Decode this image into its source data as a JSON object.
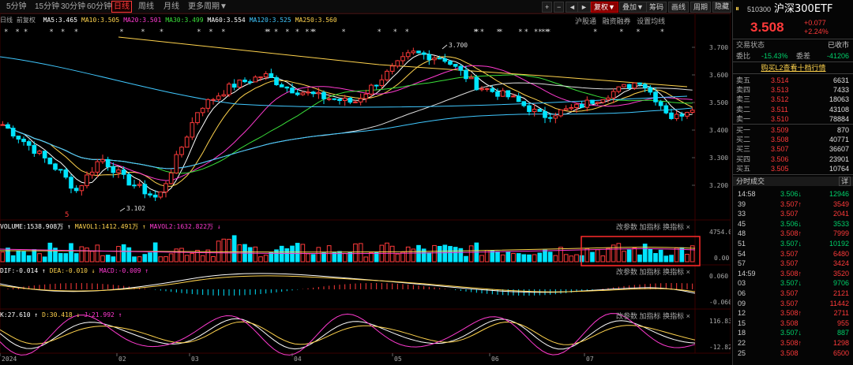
{
  "toolbar": {
    "tabs": [
      "5分钟",
      "15分钟",
      "30分钟",
      "60分钟",
      "日线",
      "周线",
      "月线",
      "更多周期"
    ],
    "active_tab": "日线",
    "more_arrow": "▼",
    "nav": [
      "+",
      "−",
      "◄",
      "►"
    ],
    "fq_label": "复权",
    "buttons": [
      "叠加",
      "筹码",
      "画线",
      "周期",
      "隐藏"
    ],
    "gear": "⚙"
  },
  "chart_header": {
    "stars_left": "* * *** *     *  *    *  *      *  *  *       ***  ** *    *",
    "legend_prefix": "日线 前复权",
    "ma": [
      {
        "label": "MA5:3.465",
        "color": "#ffffff"
      },
      {
        "label": "MA10:3.505",
        "color": "#ffd34d"
      },
      {
        "label": "MA20:3.501",
        "color": "#ff3ad0"
      },
      {
        "label": "MA30:3.499",
        "color": "#3adf3a"
      },
      {
        "label": "MA60:3.554",
        "color": "#ffffff"
      },
      {
        "label": "MA120:3.525",
        "color": "#40c8ff"
      },
      {
        "label": "MA250:3.560",
        "color": "#ffd34d"
      }
    ],
    "right_labels": [
      "沪股通",
      "融资融券",
      "设置均线"
    ],
    "high_label": "3.700",
    "low_label": "3.102",
    "low_marker": "5"
  },
  "price_axis": [
    "3.700",
    "3.600",
    "3.500",
    "3.400",
    "3.300",
    "3.200"
  ],
  "volume_pane": {
    "legend": [
      {
        "label": "VOLUME:1538.908万 ↑",
        "color": "#ffffff"
      },
      {
        "label": "MAVOL1:1412.491万 ↑",
        "color": "#ffd34d"
      },
      {
        "label": "MAVOL2:1632.822万 ↓",
        "color": "#ff3ad0"
      }
    ],
    "buttons": [
      "改参数",
      "加指标",
      "换指标",
      "×"
    ],
    "axis": [
      "4754.00",
      "0.00"
    ]
  },
  "macd_pane": {
    "legend": [
      {
        "label": "DIF:-0.014 ↑",
        "color": "#ffffff"
      },
      {
        "label": "DEA:-0.010 ↓",
        "color": "#ffd34d"
      },
      {
        "label": "MACD:-0.009 ↑",
        "color": "#ff3ad0"
      }
    ],
    "buttons": [
      "改参数",
      "加指标",
      "换指标",
      "×"
    ],
    "axis": [
      "0.060",
      "-0.060"
    ]
  },
  "kdj_pane": {
    "legend": [
      {
        "label": "K:27.610 ↑",
        "color": "#ffffff"
      },
      {
        "label": "D:30.418 ↓",
        "color": "#ffd34d"
      },
      {
        "label": "J:21.992 ↑",
        "color": "#ff3ad0"
      }
    ],
    "buttons": [
      "改参数",
      "加指标",
      "换指标",
      "×"
    ],
    "axis": [
      "116.830",
      "-12.820"
    ]
  },
  "time_axis": [
    "2024",
    "02",
    "03",
    "04",
    "05",
    "06",
    "07"
  ],
  "panel": {
    "code": "510300",
    "name": "沪深300ETF",
    "price": "3.508",
    "change": "+0.077",
    "change_pct": "+2.24%",
    "status_label": "交易状态",
    "status_value": "已收市",
    "ratio_label": "委比",
    "ratio_value": "-15.43%",
    "diff_label": "委差",
    "diff_value": "-41206",
    "level2_label": "购买L2查看十档行情",
    "asks": [
      {
        "label": "卖五",
        "price": "3.514",
        "vol": "6631"
      },
      {
        "label": "卖四",
        "price": "3.513",
        "vol": "7433"
      },
      {
        "label": "卖三",
        "price": "3.512",
        "vol": "18063"
      },
      {
        "label": "卖二",
        "price": "3.511",
        "vol": "43108"
      },
      {
        "label": "卖一",
        "price": "3.510",
        "vol": "78884"
      }
    ],
    "bids": [
      {
        "label": "买一",
        "price": "3.509",
        "vol": "870"
      },
      {
        "label": "买二",
        "price": "3.508",
        "vol": "40771"
      },
      {
        "label": "买三",
        "price": "3.507",
        "vol": "36607"
      },
      {
        "label": "买四",
        "price": "3.506",
        "vol": "23901"
      },
      {
        "label": "买五",
        "price": "3.505",
        "vol": "10764"
      }
    ],
    "trades_title": "分时成交",
    "trades_detail": "详",
    "trades": [
      {
        "time": "14:58",
        "price": "3.506",
        "dir": "↓",
        "vol": "12946",
        "color": "green"
      },
      {
        "time": "39",
        "price": "3.507",
        "dir": "↑",
        "vol": "3549",
        "color": "red"
      },
      {
        "time": "33",
        "price": "3.507",
        "dir": "",
        "vol": "2041",
        "color": "red"
      },
      {
        "time": "45",
        "price": "3.506",
        "dir": "↓",
        "vol": "3533",
        "color": "green"
      },
      {
        "time": "48",
        "price": "3.508",
        "dir": "↑",
        "vol": "7999",
        "color": "red"
      },
      {
        "time": "51",
        "price": "3.507",
        "dir": "↓",
        "vol": "10192",
        "color": "green"
      },
      {
        "time": "54",
        "price": "3.507",
        "dir": "",
        "vol": "6480",
        "color": "red"
      },
      {
        "time": "57",
        "price": "3.507",
        "dir": "",
        "vol": "3424",
        "color": "red"
      },
      {
        "time": "14:59",
        "price": "3.508",
        "dir": "↑",
        "vol": "3520",
        "color": "red"
      },
      {
        "time": "03",
        "price": "3.507",
        "dir": "↓",
        "vol": "9706",
        "color": "green"
      },
      {
        "time": "06",
        "price": "3.507",
        "dir": "",
        "vol": "2121",
        "color": "red"
      },
      {
        "time": "09",
        "price": "3.507",
        "dir": "",
        "vol": "11442",
        "color": "red"
      },
      {
        "time": "12",
        "price": "3.508",
        "dir": "↑",
        "vol": "2711",
        "color": "red"
      },
      {
        "time": "15",
        "price": "3.508",
        "dir": "",
        "vol": "955",
        "color": "red"
      },
      {
        "time": "18",
        "price": "3.507",
        "dir": "↓",
        "vol": "887",
        "color": "green"
      },
      {
        "time": "22",
        "price": "3.508",
        "dir": "↑",
        "vol": "1298",
        "color": "red"
      },
      {
        "time": "25",
        "price": "3.508",
        "dir": "",
        "vol": "6500",
        "color": "red"
      }
    ]
  },
  "colors": {
    "up": "#ff3a3a",
    "down": "#00ffff",
    "bg": "#000000"
  }
}
